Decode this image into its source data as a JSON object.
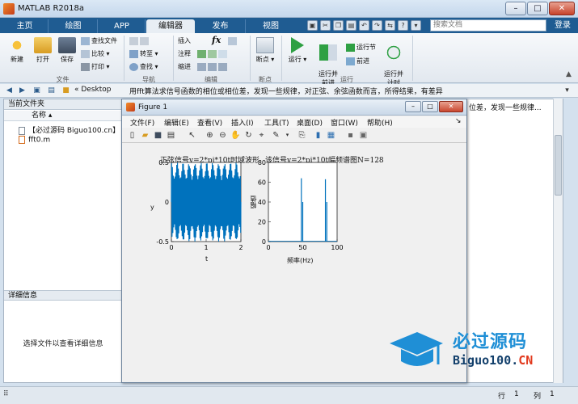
{
  "window": {
    "title": "MATLAB R2018a"
  },
  "tabs": [
    "主页",
    "绘图",
    "APP",
    "编辑器",
    "发布",
    "视图"
  ],
  "active_tab": "编辑器",
  "search": {
    "placeholder": "搜索文档"
  },
  "login_label": "登录",
  "ribbon": {
    "file_group": {
      "label": "文件",
      "new": "新建",
      "open": "打开",
      "save": "保存",
      "find_files": "查找文件",
      "compare": "比较",
      "print": "打印"
    },
    "nav_group": {
      "label": "导航",
      "goto": "转至",
      "find": "查找"
    },
    "edit_group": {
      "label": "编辑",
      "insert": "插入",
      "comment": "注释",
      "indent": "缩进",
      "fx": "fx"
    },
    "breakpoint_group": {
      "label": "断点",
      "breakpoints": "断点"
    },
    "run_group": {
      "label": "运行",
      "run": "运行",
      "run_advance": "运行并\n前进",
      "run_section": "运行节",
      "advance": "前进",
      "run_time": "运行并\n计时"
    }
  },
  "address": {
    "path": "« Desktop",
    "desc": "用fft算法求信号函数的相位或相位差，发现一些规律，对正弦、余弦函数而言，所得结果，有差异"
  },
  "current_folder": {
    "title": "当前文件夹",
    "column": "名称",
    "files": [
      "【必过源码 Biguo100.cn】",
      "fft0.m"
    ]
  },
  "details": {
    "title": "详细信息",
    "hint": "选择文件以查看详细信息"
  },
  "editor_snippet": "位差，发现一些规律...",
  "status": {
    "row_label": "行",
    "row": "1",
    "col_label": "列",
    "col": "1"
  },
  "figure": {
    "title": "Figure 1",
    "menus": [
      "文件(F)",
      "编辑(E)",
      "查看(V)",
      "插入(I)",
      "工具(T)",
      "桌面(D)",
      "窗口(W)",
      "帮助(H)"
    ]
  },
  "chart_data": [
    {
      "type": "line",
      "title": "正弦信号y=2*pi*10t时域波形",
      "xlabel": "t",
      "ylabel": "y",
      "xlim": [
        0,
        2
      ],
      "ylim": [
        -0.5,
        0.5
      ],
      "xticks": [
        0,
        1,
        2
      ],
      "yticks": [
        -0.5,
        0,
        0.5
      ],
      "description_of_series": "dense sinusoid, amplitude ~0.5, fills plot area",
      "color": "#0072bd"
    },
    {
      "type": "bar",
      "title": "该信号y=2*pi*10t幅频谱图N=128",
      "xlabel": "频率(Hz)",
      "ylabel": "幅值",
      "xlim": [
        0,
        100
      ],
      "ylim": [
        0,
        80
      ],
      "xticks": [
        0,
        50,
        100
      ],
      "yticks": [
        0,
        20,
        40,
        60,
        80
      ],
      "x": [
        48,
        50,
        83,
        85
      ],
      "values": [
        64,
        40,
        63,
        40
      ],
      "color": "#0072bd"
    }
  ],
  "watermark": {
    "cn": "必过源码",
    "en_main": "Biguo100.",
    "en_suffix": "CN"
  }
}
